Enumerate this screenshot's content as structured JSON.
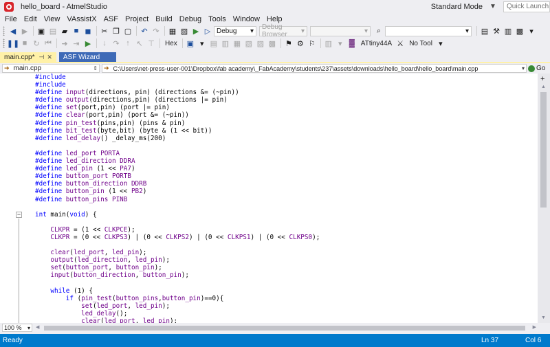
{
  "window": {
    "title": "hello_board - AtmelStudio",
    "mode": "Standard Mode",
    "quick_launch_placeholder": "Quick Launch (C"
  },
  "menu": [
    "File",
    "Edit",
    "View",
    "VAssistX",
    "ASF",
    "Project",
    "Build",
    "Debug",
    "Tools",
    "Window",
    "Help"
  ],
  "toolbar": {
    "config": "Debug",
    "debug_browser": "Debug Browser",
    "hex_label": "Hex",
    "device": "ATtiny44A",
    "tool": "No Tool"
  },
  "tabs": {
    "active": "main.cpp*",
    "inactive": "ASF Wizard"
  },
  "navbar": {
    "file": "main.cpp",
    "path": "C:\\Users\\net-press-user-001\\Dropbox\\fab academy\\_FabAcademy\\students\\237\\assets\\downloads\\hello_board\\hello_board\\main.cpp",
    "go_label": "Go"
  },
  "code_lines": [
    [
      {
        "t": "#include",
        "c": "kw"
      }
    ],
    [
      {
        "t": "#include",
        "c": "kw"
      }
    ],
    [
      {
        "t": "#define ",
        "c": "kw"
      },
      {
        "t": "input",
        "c": "mac"
      },
      {
        "t": "(directions, pin) (directions &= (~pin))"
      }
    ],
    [
      {
        "t": "#define ",
        "c": "kw"
      },
      {
        "t": "output",
        "c": "mac"
      },
      {
        "t": "(directions,pin) (directions |= pin)"
      }
    ],
    [
      {
        "t": "#define ",
        "c": "kw"
      },
      {
        "t": "set",
        "c": "mac"
      },
      {
        "t": "(port,pin) (port |= pin)"
      }
    ],
    [
      {
        "t": "#define ",
        "c": "kw"
      },
      {
        "t": "clear",
        "c": "mac"
      },
      {
        "t": "(port,pin) (port &= (~pin))"
      }
    ],
    [
      {
        "t": "#define ",
        "c": "kw"
      },
      {
        "t": "pin_test",
        "c": "mac"
      },
      {
        "t": "(pins,pin) (pins & pin)"
      }
    ],
    [
      {
        "t": "#define ",
        "c": "kw"
      },
      {
        "t": "bit_test",
        "c": "mac"
      },
      {
        "t": "(byte,bit) (byte & (1 << bit))"
      }
    ],
    [
      {
        "t": "#define ",
        "c": "kw"
      },
      {
        "t": "led_delay",
        "c": "mac"
      },
      {
        "t": "() _delay_ms(200)"
      }
    ],
    [],
    [
      {
        "t": "#define ",
        "c": "kw"
      },
      {
        "t": "led_port",
        "c": "mac"
      },
      {
        "t": " "
      },
      {
        "t": "PORTA",
        "c": "mac"
      }
    ],
    [
      {
        "t": "#define ",
        "c": "kw"
      },
      {
        "t": "led_direction",
        "c": "mac"
      },
      {
        "t": " "
      },
      {
        "t": "DDRA",
        "c": "mac"
      }
    ],
    [
      {
        "t": "#define ",
        "c": "kw"
      },
      {
        "t": "led_pin",
        "c": "mac"
      },
      {
        "t": " (1 << "
      },
      {
        "t": "PA7",
        "c": "mac"
      },
      {
        "t": ")"
      }
    ],
    [
      {
        "t": "#define ",
        "c": "kw"
      },
      {
        "t": "button_port",
        "c": "mac"
      },
      {
        "t": " "
      },
      {
        "t": "PORTB",
        "c": "mac"
      }
    ],
    [
      {
        "t": "#define ",
        "c": "kw"
      },
      {
        "t": "button_direction",
        "c": "mac"
      },
      {
        "t": " "
      },
      {
        "t": "DDRB",
        "c": "mac"
      }
    ],
    [
      {
        "t": "#define ",
        "c": "kw"
      },
      {
        "t": "button_pin",
        "c": "mac"
      },
      {
        "t": " (1 << "
      },
      {
        "t": "PB2",
        "c": "mac"
      },
      {
        "t": ")"
      }
    ],
    [
      {
        "t": "#define ",
        "c": "kw"
      },
      {
        "t": "button_pins",
        "c": "mac"
      },
      {
        "t": " "
      },
      {
        "t": "PINB",
        "c": "mac"
      }
    ],
    [],
    [
      {
        "t": "int",
        "c": "kw"
      },
      {
        "t": " main("
      },
      {
        "t": "void",
        "c": "kw"
      },
      {
        "t": ") {"
      }
    ],
    [],
    [
      {
        "t": "    "
      },
      {
        "t": "CLKPR",
        "c": "mac"
      },
      {
        "t": " = (1 << "
      },
      {
        "t": "CLKPCE",
        "c": "mac"
      },
      {
        "t": ");"
      }
    ],
    [
      {
        "t": "    "
      },
      {
        "t": "CLKPR",
        "c": "mac"
      },
      {
        "t": " = (0 << "
      },
      {
        "t": "CLKPS3",
        "c": "mac"
      },
      {
        "t": ") | (0 << "
      },
      {
        "t": "CLKPS2",
        "c": "mac"
      },
      {
        "t": ") | (0 << "
      },
      {
        "t": "CLKPS1",
        "c": "mac"
      },
      {
        "t": ") | (0 << "
      },
      {
        "t": "CLKPS0",
        "c": "mac"
      },
      {
        "t": ");"
      }
    ],
    [],
    [
      {
        "t": "    "
      },
      {
        "t": "clear",
        "c": "mac"
      },
      {
        "t": "("
      },
      {
        "t": "led_port",
        "c": "mac"
      },
      {
        "t": ", "
      },
      {
        "t": "led_pin",
        "c": "mac"
      },
      {
        "t": ");"
      }
    ],
    [
      {
        "t": "    "
      },
      {
        "t": "output",
        "c": "mac"
      },
      {
        "t": "("
      },
      {
        "t": "led_direction",
        "c": "mac"
      },
      {
        "t": ", "
      },
      {
        "t": "led_pin",
        "c": "mac"
      },
      {
        "t": ");"
      }
    ],
    [
      {
        "t": "    "
      },
      {
        "t": "set",
        "c": "mac"
      },
      {
        "t": "("
      },
      {
        "t": "button_port",
        "c": "mac"
      },
      {
        "t": ", "
      },
      {
        "t": "button_pin",
        "c": "mac"
      },
      {
        "t": ");"
      }
    ],
    [
      {
        "t": "    "
      },
      {
        "t": "input",
        "c": "mac"
      },
      {
        "t": "("
      },
      {
        "t": "button_direction",
        "c": "mac"
      },
      {
        "t": ", "
      },
      {
        "t": "button_pin",
        "c": "mac"
      },
      {
        "t": ");"
      }
    ],
    [],
    [
      {
        "t": "    "
      },
      {
        "t": "while",
        "c": "kw"
      },
      {
        "t": " (1) {"
      }
    ],
    [
      {
        "t": "        "
      },
      {
        "t": "if",
        "c": "kw"
      },
      {
        "t": " ("
      },
      {
        "t": "pin_test",
        "c": "mac"
      },
      {
        "t": "("
      },
      {
        "t": "button_pins",
        "c": "mac"
      },
      {
        "t": ","
      },
      {
        "t": "button_pin",
        "c": "mac"
      },
      {
        "t": ")==0){"
      }
    ],
    [
      {
        "t": "            "
      },
      {
        "t": "set",
        "c": "mac"
      },
      {
        "t": "("
      },
      {
        "t": "led_port",
        "c": "mac"
      },
      {
        "t": ", "
      },
      {
        "t": "led_pin",
        "c": "mac"
      },
      {
        "t": ");"
      }
    ],
    [
      {
        "t": "            "
      },
      {
        "t": "led_delay",
        "c": "mac"
      },
      {
        "t": "();"
      }
    ],
    [
      {
        "t": "            "
      },
      {
        "t": "clear",
        "c": "mac"
      },
      {
        "t": "("
      },
      {
        "t": "led_port",
        "c": "mac"
      },
      {
        "t": ", "
      },
      {
        "t": "led_pin",
        "c": "mac"
      },
      {
        "t": ");"
      }
    ]
  ],
  "zoom": "100 %",
  "status": {
    "text": "Ready",
    "ln": "Ln 37",
    "col": "Col 6"
  }
}
